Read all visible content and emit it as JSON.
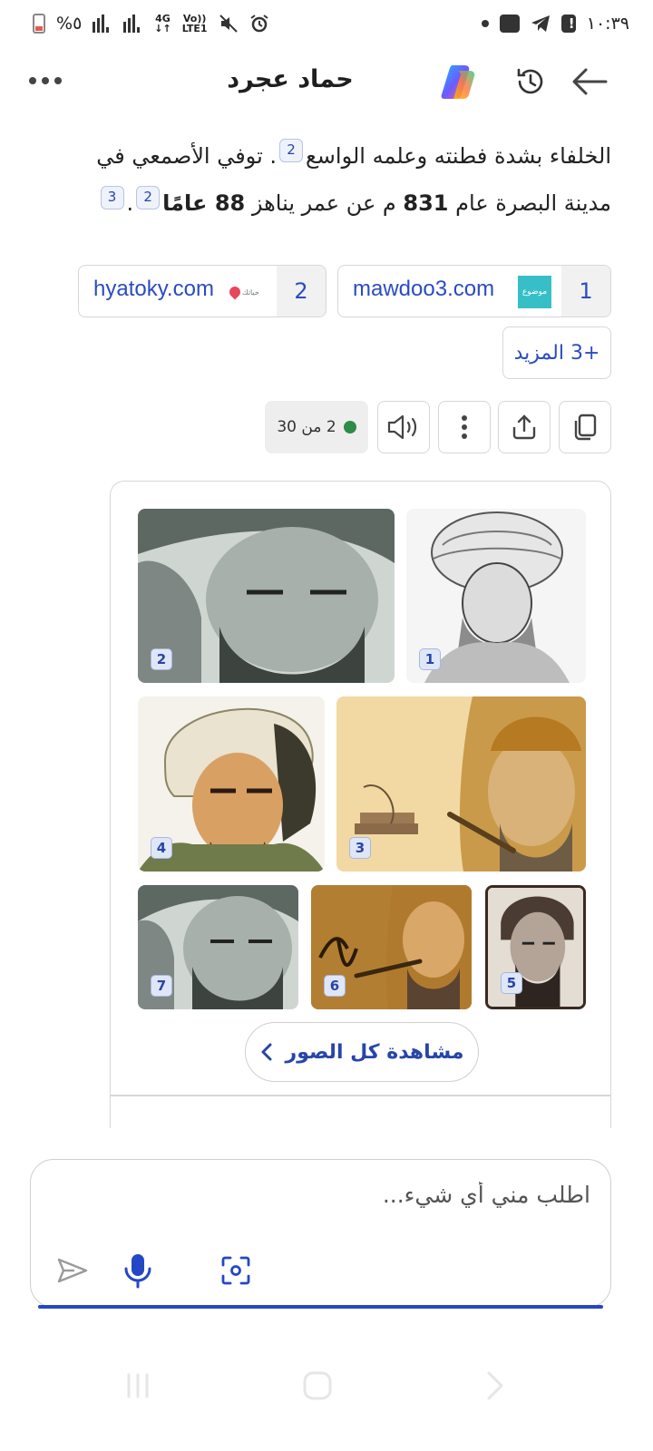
{
  "status_bar": {
    "time": "١٠:٣٩",
    "battery": "%٥",
    "net_top": "4G",
    "net_bottom": "↓↑",
    "volte_top": "Vo))",
    "volte_bottom": "LTE1"
  },
  "header": {
    "title": "حماد عجرد",
    "more_label": "More options",
    "history_label": "History",
    "back_label": "Back"
  },
  "answer": {
    "line1_text_a": "الخلفاء بشدة فطنته وعلمه الواسع",
    "line1_cite": "2",
    "line1_text_b": ". توفي الأصمعي في",
    "line2_text_a": "مدينة البصرة عام",
    "line2_year": "831",
    "line2_text_b": "م عن عمر يناهز",
    "line2_age": "88 عامًا",
    "line2_cite_a": "2",
    "line2_dot": ".",
    "line2_cite_b": "3"
  },
  "sources": [
    {
      "num": "1",
      "name": "mawdoo3.com",
      "favicon_text": "موضوع"
    },
    {
      "num": "2",
      "name": "hyatoky.com",
      "favicon_text": "حياتك"
    }
  ],
  "more_sources": "+3 المزيد",
  "actions": {
    "copy": "copy-icon",
    "share": "share-icon",
    "more": "more-vertical-icon",
    "speaker": "speaker-icon",
    "counter": "2 من 30"
  },
  "gallery": {
    "images": [
      {
        "badge": "1",
        "desc": "portrait"
      },
      {
        "badge": "2",
        "desc": "portrait"
      },
      {
        "badge": "3",
        "desc": "portrait"
      },
      {
        "badge": "4",
        "desc": "portrait"
      },
      {
        "badge": "5",
        "desc": "portrait"
      },
      {
        "badge": "6",
        "desc": "portrait"
      },
      {
        "badge": "7",
        "desc": "portrait"
      }
    ],
    "see_all": "مشاهدة كل الصور"
  },
  "composer": {
    "placeholder": "اطلب مني أي شيء..."
  },
  "colors": {
    "accent": "#2447c5",
    "link": "#2a4cc0",
    "status_green": "#2e8b48"
  }
}
